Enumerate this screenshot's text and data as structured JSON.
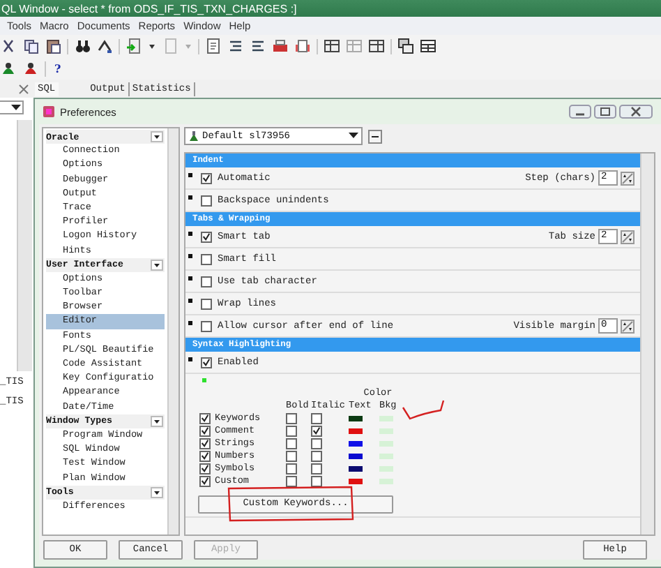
{
  "window": {
    "title": "QL Window - select * from ODS_IF_TIS_TXN_CHARGES :]"
  },
  "menu": [
    "Tools",
    "Macro",
    "Documents",
    "Reports",
    "Window",
    "Help"
  ],
  "help_glyph": "?",
  "result_tabs": [
    {
      "label": "SQL",
      "selected": true
    },
    {
      "label": "Output",
      "selected": false
    },
    {
      "label": "Statistics",
      "selected": false
    }
  ],
  "background_rows": [
    "_TIS",
    "_TIS"
  ],
  "dialog": {
    "title": "Preferences",
    "tree": [
      {
        "label": "Oracle",
        "children": [
          {
            "label": "Connection",
            "selected": false
          },
          {
            "label": "Options",
            "selected": false
          },
          {
            "label": "Debugger",
            "selected": false
          },
          {
            "label": "Output",
            "selected": false
          },
          {
            "label": "Trace",
            "selected": false
          },
          {
            "label": "Profiler",
            "selected": false
          },
          {
            "label": "Logon History",
            "selected": false
          },
          {
            "label": "Hints",
            "selected": false
          }
        ]
      },
      {
        "label": "User Interface",
        "children": [
          {
            "label": "Options",
            "selected": false
          },
          {
            "label": "Toolbar",
            "selected": false
          },
          {
            "label": "Browser",
            "selected": false
          },
          {
            "label": "Editor",
            "selected": true
          },
          {
            "label": "Fonts",
            "selected": false
          },
          {
            "label": "PL/SQL Beautifie",
            "selected": false
          },
          {
            "label": "Code Assistant",
            "selected": false
          },
          {
            "label": "Key Configuratio",
            "selected": false
          },
          {
            "label": "Appearance",
            "selected": false
          },
          {
            "label": "Date/Time",
            "selected": false
          }
        ]
      },
      {
        "label": "Window Types",
        "children": [
          {
            "label": "Program Window",
            "selected": false
          },
          {
            "label": "SQL Window",
            "selected": false
          },
          {
            "label": "Test Window",
            "selected": false
          },
          {
            "label": "Plan Window",
            "selected": false
          }
        ]
      },
      {
        "label": "Tools",
        "children": [
          {
            "label": "Differences",
            "selected": false
          }
        ]
      }
    ],
    "profile": "Default sl73956",
    "sections": [
      {
        "title": "Indent",
        "rows": [
          {
            "label": "Automatic",
            "checked": true,
            "field_label": "Step (chars)",
            "value": "2"
          },
          {
            "label": "Backspace unindents",
            "checked": false
          }
        ]
      },
      {
        "title": "Tabs & Wrapping",
        "rows": [
          {
            "label": "Smart tab",
            "checked": true,
            "field_label": "Tab size",
            "value": "2"
          },
          {
            "label": "Smart fill",
            "checked": false
          },
          {
            "label": "Use tab character",
            "checked": false
          },
          {
            "label": "Wrap lines",
            "checked": false
          },
          {
            "label": "Allow cursor after end of line",
            "checked": false,
            "field_label": "Visible margin",
            "value": "0"
          }
        ]
      },
      {
        "title": "Syntax Highlighting",
        "rows": [
          {
            "label": "Enabled",
            "checked": true
          }
        ]
      }
    ],
    "highlighting": {
      "color_heading": "Color",
      "columns": [
        "Bold",
        "Italic",
        "Text",
        "Bkg"
      ],
      "items": [
        {
          "label": "Keywords",
          "checked": true,
          "bold": false,
          "italic": false,
          "color": "#0b3a12",
          "bkg": {
            "color": "#d6f2d6"
          }
        },
        {
          "label": "Comment",
          "checked": true,
          "bold": false,
          "italic": true,
          "color": "#e01010",
          "bkg": {
            "color": "#d6f2d6"
          }
        },
        {
          "label": "Strings",
          "checked": true,
          "bold": false,
          "italic": false,
          "color": "#1010e8",
          "bkg": {
            "color": "#d6f2d6"
          }
        },
        {
          "label": "Numbers",
          "checked": true,
          "bold": false,
          "italic": false,
          "color": "#0a0ad0",
          "bkg": {
            "color": "#d6f2d6"
          }
        },
        {
          "label": "Symbols",
          "checked": true,
          "bold": false,
          "italic": false,
          "color": "#0a0a70",
          "bkg": {
            "color": "#d6f2d6"
          }
        },
        {
          "label": "Custom",
          "checked": true,
          "bold": false,
          "italic": false,
          "color": "#e01010",
          "bkg": {
            "color": "#d6f2d6"
          }
        }
      ],
      "button": "Custom Keywords..."
    },
    "buttons": [
      {
        "label": "OK",
        "disabled": false
      },
      {
        "label": "Cancel",
        "disabled": false
      },
      {
        "label": "Apply",
        "disabled": true
      },
      {
        "label": "Help",
        "disabled": false
      }
    ]
  }
}
